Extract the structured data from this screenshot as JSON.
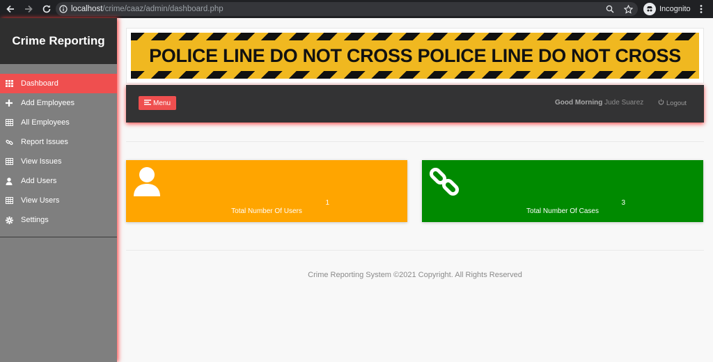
{
  "browser": {
    "url_host": "localhost",
    "url_path": "/crime/caaz/admin/dashboard.php",
    "incognito_label": "Incognito"
  },
  "sidebar": {
    "brand": "Crime Reporting",
    "items": [
      {
        "label": "Dashboard",
        "icon": "grid-icon",
        "active": true
      },
      {
        "label": "Add Employees",
        "icon": "plus-icon"
      },
      {
        "label": "All Employees",
        "icon": "table-icon"
      },
      {
        "label": "Report Issues",
        "icon": "link-icon"
      },
      {
        "label": "View Issues",
        "icon": "table-icon"
      },
      {
        "label": "Add Users",
        "icon": "user-icon"
      },
      {
        "label": "View Users",
        "icon": "table-icon"
      },
      {
        "label": "Settings",
        "icon": "gear-icon"
      }
    ]
  },
  "banner": {
    "text": "POLICE LINE DO NOT CROSS POLICE LINE DO NOT CROSS"
  },
  "topbar": {
    "menu_label": "Menu",
    "greeting": "Good Morning",
    "user_name": "Jude Suarez",
    "logout_label": "Logout"
  },
  "cards": {
    "users": {
      "count": "1",
      "caption": "Total Number Of Users",
      "color": "#ffa500"
    },
    "cases": {
      "count": "3",
      "caption": "Total Number Of Cases",
      "color": "#008a00"
    }
  },
  "footer": {
    "text": "Crime Reporting System ©2021 Copyright. All Rights Reserved"
  },
  "colors": {
    "accent": "#ef4f4f",
    "sidebar": "#7f7f7f",
    "brand_bg": "#2f2f2f",
    "topbar": "#333334"
  }
}
